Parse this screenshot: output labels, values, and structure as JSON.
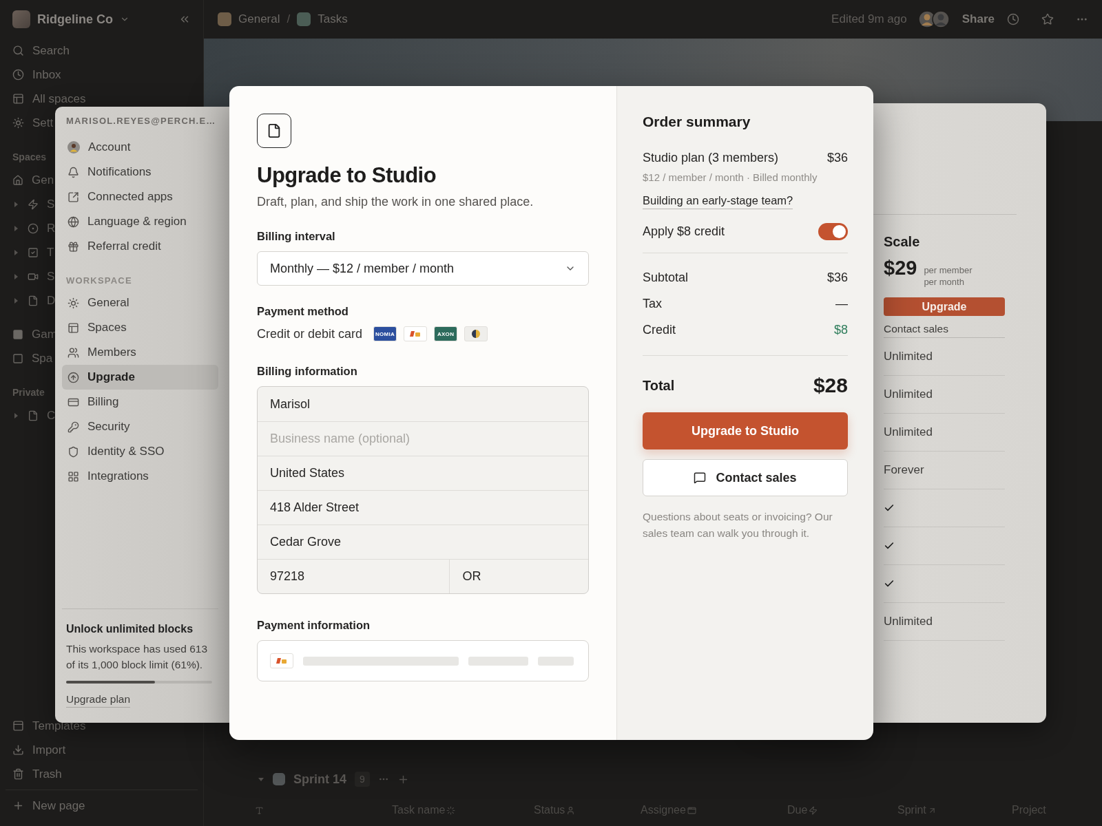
{
  "sidebar": {
    "workspace": "Ridgeline Co",
    "nav": [
      {
        "label": "Search"
      },
      {
        "label": "Inbox"
      },
      {
        "label": "All spaces"
      },
      {
        "label": "Sett"
      }
    ],
    "spaces_heading": "Spaces",
    "spaces": [
      {
        "label": "Gen",
        "expandable": false
      },
      {
        "label": "S",
        "expandable": true
      },
      {
        "label": "R",
        "expandable": true
      },
      {
        "label": "T",
        "expandable": true
      },
      {
        "label": "S",
        "expandable": true
      },
      {
        "label": "D",
        "expandable": true
      },
      {
        "label": "Gam",
        "expandable": false
      },
      {
        "label": "Spa",
        "expandable": false
      }
    ],
    "private_heading": "Private",
    "private": [
      {
        "label": "C",
        "expandable": true
      }
    ],
    "footer": [
      {
        "label": "Templates"
      },
      {
        "label": "Import"
      },
      {
        "label": "Trash"
      }
    ],
    "new_page": "New page"
  },
  "topbar": {
    "breadcrumbs": [
      {
        "label": "General",
        "color": "#6e5d48"
      },
      {
        "label": "Tasks",
        "color": "#4b5d55"
      }
    ],
    "separator": "/",
    "edited": "Edited 9m ago",
    "share": "Share"
  },
  "group": {
    "title": "Sprint 14",
    "count": "9",
    "expanded": true
  },
  "columns": [
    "Task name",
    "Status",
    "Assignee",
    "Due",
    "Sprint",
    "Project"
  ],
  "settings": {
    "email": "MARISOL.REYES@PERCH.E…",
    "account_items": [
      {
        "label": "Account",
        "selected": false
      },
      {
        "label": "Notifications",
        "selected": false
      },
      {
        "label": "Connected apps",
        "selected": false
      },
      {
        "label": "Language & region",
        "selected": false
      },
      {
        "label": "Referral credit",
        "selected": false
      }
    ],
    "workspace_heading": "WORKSPACE",
    "workspace_items": [
      {
        "label": "General",
        "selected": false
      },
      {
        "label": "Spaces",
        "selected": false
      },
      {
        "label": "Members",
        "selected": false
      },
      {
        "label": "Upgrade",
        "selected": true
      },
      {
        "label": "Billing",
        "selected": false
      },
      {
        "label": "Security",
        "selected": false
      },
      {
        "label": "Identity & SSO",
        "selected": false
      },
      {
        "label": "Integrations",
        "selected": false
      }
    ],
    "usage": {
      "title": "Unlock unlimited blocks",
      "text": "This workspace has used 613 of its 1,000 block limit (61%).",
      "level": 0.61,
      "link": "Upgrade plan"
    }
  },
  "plan": {
    "name": "Scale",
    "price": "$29",
    "unit_lines": [
      "per member",
      "per month"
    ],
    "button": "Upgrade",
    "contact": "Contact sales",
    "rows": [
      {
        "kind": "text",
        "text": "Unlimited"
      },
      {
        "kind": "text",
        "text": "Unlimited"
      },
      {
        "kind": "text",
        "text": "Unlimited"
      },
      {
        "kind": "text",
        "text": "Forever"
      },
      {
        "kind": "check"
      },
      {
        "kind": "check"
      },
      {
        "kind": "check"
      },
      {
        "kind": "text",
        "text": "Unlimited"
      }
    ]
  },
  "modal": {
    "title": "Upgrade to Studio",
    "subtitle": "Draft, plan, and ship the work in one shared place.",
    "billing_interval": {
      "label": "Billing interval",
      "value": "Monthly — $12 / member / month"
    },
    "payment_method": {
      "label": "Payment method",
      "option": "Credit or debit card",
      "cards": [
        {
          "kind": "text",
          "label": "NOMIA",
          "color": "#2c4f9e"
        },
        {
          "kind": "stripes",
          "color": "#ffffff"
        },
        {
          "kind": "text",
          "label": "AXON",
          "color": "#2d6b5c"
        },
        {
          "kind": "half-circle",
          "color": "#efeeeb"
        }
      ]
    },
    "billing_info": {
      "label": "Billing information",
      "fields": [
        {
          "value": "Marisol"
        },
        {
          "placeholder": "Business name (optional)"
        },
        {
          "value": "United States"
        },
        {
          "value": "418 Alder Street"
        },
        {
          "value": "Cedar Grove"
        }
      ],
      "split": [
        {
          "value": "97218"
        },
        {
          "value": "OR"
        }
      ]
    },
    "payment_info": {
      "label": "Payment information"
    }
  },
  "summary": {
    "title": "Order summary",
    "line": {
      "label": "Studio plan (3 members)",
      "amount": "$36",
      "detail": "$12 / member / month · Billed monthly"
    },
    "link": "Building an early-stage team?",
    "credit_toggle": {
      "label": "Apply $8 credit",
      "on": true
    },
    "rows": [
      {
        "label": "Subtotal",
        "value": "$36",
        "color": "#262524"
      },
      {
        "label": "Tax",
        "value": "—",
        "color": "#262524"
      },
      {
        "label": "Credit",
        "value": "$8",
        "color": "#2e7d5b"
      }
    ],
    "total": {
      "label": "Total",
      "value": "$28"
    },
    "primary": "Upgrade to Studio",
    "secondary": "Contact sales",
    "note": "Questions about seats or invoicing? Our sales team can walk you through it."
  }
}
